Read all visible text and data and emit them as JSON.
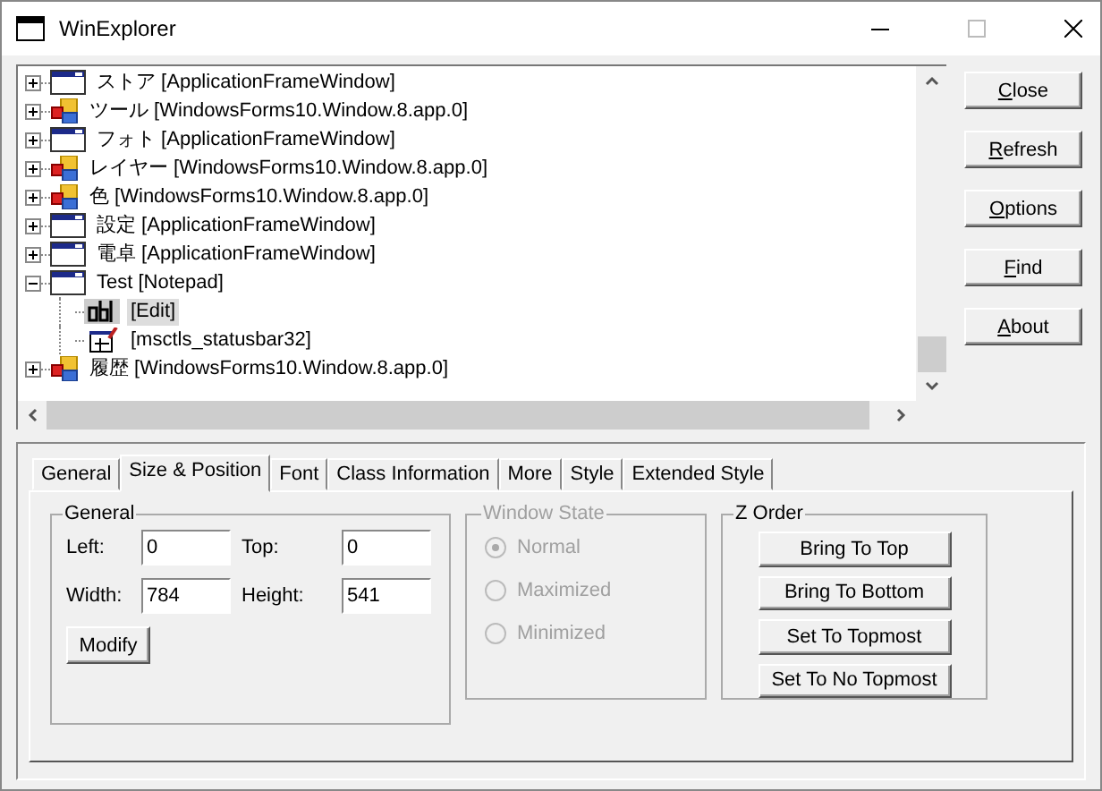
{
  "window": {
    "title": "WinExplorer"
  },
  "tree": [
    {
      "label": "ストア [ApplicationFrameWindow]",
      "kind": "window",
      "expanded": false,
      "selected": false
    },
    {
      "label": "ツール [WindowsForms10.Window.8.app.0]",
      "kind": "forms",
      "expanded": false,
      "selected": false
    },
    {
      "label": "フォト [ApplicationFrameWindow]",
      "kind": "window",
      "expanded": false,
      "selected": false
    },
    {
      "label": "レイヤー [WindowsForms10.Window.8.app.0]",
      "kind": "forms",
      "expanded": false,
      "selected": false
    },
    {
      "label": "色 [WindowsForms10.Window.8.app.0]",
      "kind": "forms",
      "expanded": false,
      "selected": false
    },
    {
      "label": "設定 [ApplicationFrameWindow]",
      "kind": "window",
      "expanded": false,
      "selected": false
    },
    {
      "label": "電卓 [ApplicationFrameWindow]",
      "kind": "window",
      "expanded": false,
      "selected": false
    },
    {
      "label": "Test [Notepad]",
      "kind": "window",
      "expanded": true,
      "selected": false,
      "children": [
        {
          "label": "[Edit]",
          "kind": "edit",
          "selected": true
        },
        {
          "label": "[msctls_statusbar32]",
          "kind": "statusbar",
          "selected": false
        }
      ]
    },
    {
      "label": "履歴 [WindowsForms10.Window.8.app.0]",
      "kind": "forms",
      "expanded": false,
      "selected": false
    }
  ],
  "side_buttons": [
    {
      "label": "Close"
    },
    {
      "label": "Refresh"
    },
    {
      "label": "Options"
    },
    {
      "label": "Find"
    },
    {
      "label": "About"
    }
  ],
  "tabs": [
    {
      "label": "General",
      "selected": false
    },
    {
      "label": "Size & Position",
      "selected": true
    },
    {
      "label": "Font",
      "selected": false
    },
    {
      "label": "Class Information",
      "selected": false
    },
    {
      "label": "More",
      "selected": false
    },
    {
      "label": "Style",
      "selected": false
    },
    {
      "label": "Extended Style",
      "selected": false
    }
  ],
  "general": {
    "title": "General",
    "fields": [
      {
        "label": "Left:",
        "value": "0"
      },
      {
        "label": "Top:",
        "value": "0"
      },
      {
        "label": "Width:",
        "value": "784"
      },
      {
        "label": "Height:",
        "value": "541"
      }
    ],
    "button": "Modify"
  },
  "window_state": {
    "title": "Window State",
    "disabled": true,
    "options": [
      {
        "label": "Normal",
        "selected": true
      },
      {
        "label": "Maximized",
        "selected": false
      },
      {
        "label": "Minimized",
        "selected": false
      }
    ]
  },
  "z_order": {
    "title": "Z Order",
    "buttons": [
      "Bring To Top",
      "Bring To Bottom",
      "Set To Topmost",
      "Set To No Topmost"
    ]
  }
}
